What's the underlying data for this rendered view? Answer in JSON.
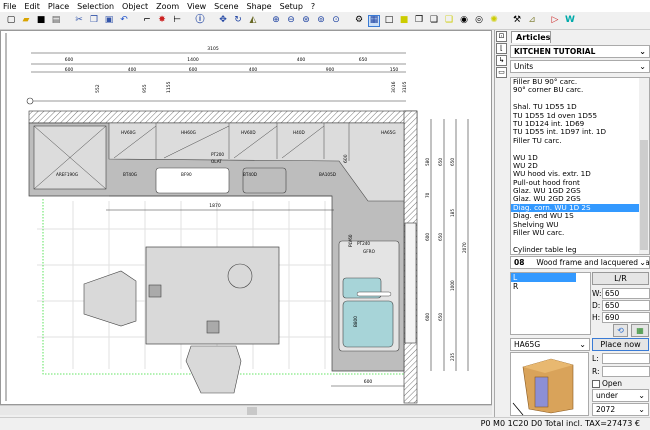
{
  "menu": [
    "File",
    "Edit",
    "Place",
    "Selection",
    "Object",
    "Zoom",
    "View",
    "Scene",
    "Shape",
    "Setup",
    "?"
  ],
  "toolbar_icons": [
    "new-icon",
    "open-icon",
    "save-icon",
    "print-icon",
    "cut-icon",
    "copy-icon",
    "paste-icon",
    "undo-icon",
    "stairs-icon",
    "paint-icon",
    "dimension-icon",
    "info-icon",
    "move-icon",
    "rotate-icon",
    "mirror-icon",
    "zoom-in-icon",
    "zoom-out-icon",
    "zoom-window-icon",
    "zoom-all-icon",
    "zoom-previous-icon",
    "camera-view-icon",
    "plan-view-icon",
    "wireframe-icon",
    "solid-icon",
    "box-icon",
    "box-open-icon",
    "box-filled-icon",
    "camera-icon",
    "camera-2-icon",
    "light-icon",
    "tools-icon",
    "measure-icon",
    "export-icon",
    "web-icon"
  ],
  "drawing": {
    "dims_top": {
      "total": "3105",
      "row1": [
        "600",
        "1400",
        "400",
        "650"
      ],
      "row2": [
        "600",
        "400",
        "600",
        "400",
        "900",
        "150"
      ],
      "marks": [
        "552",
        "955",
        "1155",
        "3016",
        "3105"
      ]
    },
    "dims_right": {
      "col1": [
        "580",
        "70",
        "600",
        "600"
      ],
      "col2": [
        "650",
        "650",
        "650"
      ],
      "col3": [
        "650",
        "185",
        "1000",
        "235"
      ],
      "col4": [
        "2070"
      ]
    },
    "dim_bottom": "600",
    "dim_inner": "1870",
    "dim_corner": "600",
    "labels": {
      "aref": "AREF190G",
      "bt40g": "BT40G",
      "bf90": "BF90",
      "bt40d": "BT40D",
      "ba105d": "BA105D",
      "hv60g": "HV60G",
      "hh60g": "HH60G",
      "hv60d": "HV60D",
      "h40d": "H40D",
      "ha65g": "HA65G",
      "pt200": "PT200",
      "olat": "OLAT",
      "plv60": "PLV60",
      "pt240": "PT240",
      "gfro": "GFRO",
      "b800": "B800"
    }
  },
  "status": "P0 M0 1C20 D0 Total incl. TAX=27473 €",
  "panel": {
    "tab": "Articles",
    "catalog": "KITCHEN TUTORIAL",
    "category": "Units",
    "items": [
      "Filler BU 90° carc.",
      "90° corner BU carc.",
      "",
      "Shal. TU 1D55 1D",
      "TU 1D55 1d oven 1D55",
      "TU 1D124 int. 1D69",
      "TU 1D55 int. 1D97 int. 1D",
      "Filler TU carc.",
      "",
      "WU 1D",
      "WU 2D",
      "WU hood vis. extr. 1D",
      "Pull-out hood front",
      "Glaz. WU 1GD 2GS",
      "Glaz. WU 2GD 2GS",
      "Diag. corn. WU 1D 2S",
      "Diag. end WU 1S",
      "Shelving WU",
      "Filler WU carc.",
      "",
      "Cylinder table leg"
    ],
    "selected_index": 15,
    "finish_code": "08",
    "finish_name": "Wood frame and lacquered par",
    "hinge_options": [
      "L",
      "R"
    ],
    "lr_button": "L/R",
    "w_label": "W:",
    "w": "650",
    "d_label": "D:",
    "d": "650",
    "h_label": "H:",
    "h": "690",
    "model": "HA65G",
    "place_button": "Place now",
    "l_label": "L:",
    "l": "",
    "r_label": "R:",
    "r": "",
    "open_label": "Open",
    "open_checked": false,
    "position": "under",
    "height_value": "2072"
  }
}
